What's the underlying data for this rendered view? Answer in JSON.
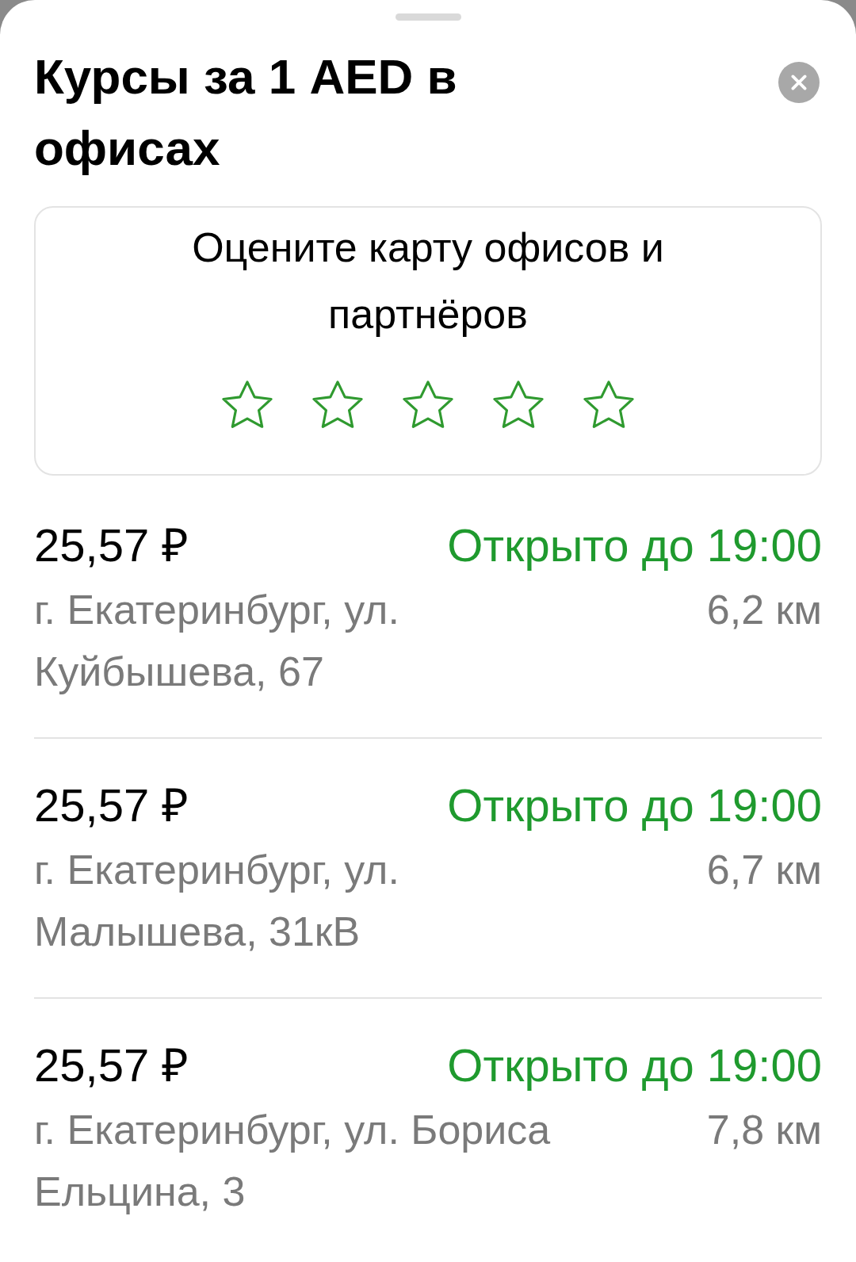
{
  "sheet": {
    "title": "Курсы за 1 AED в офисах"
  },
  "rating_card": {
    "prompt": "Оцените карту офисов и партнёров",
    "stars": 0
  },
  "offices": [
    {
      "rate": "25,57 ₽",
      "status": "Открыто до 19:00",
      "address": "г. Екатеринбург, ул. Куйбышева, 67",
      "distance": "6,2 км"
    },
    {
      "rate": "25,57 ₽",
      "status": "Открыто до 19:00",
      "address": "г. Екатеринбург, ул. Малышева, 31кВ",
      "distance": "6,7 км"
    },
    {
      "rate": "25,57 ₽",
      "status": "Открыто до 19:00",
      "address": "г. Екатеринбург, ул. Бориса Ельцина, 3",
      "distance": "7,8 км"
    }
  ]
}
